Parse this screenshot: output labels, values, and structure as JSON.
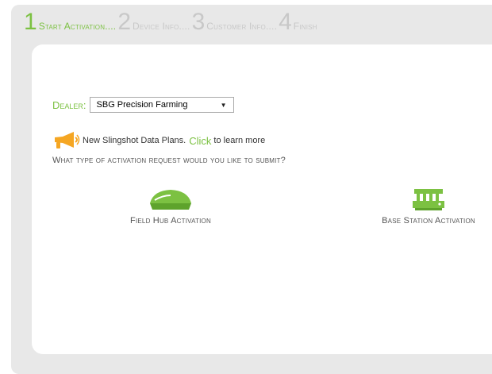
{
  "steps": [
    {
      "number": "1",
      "label": "Start Activation....",
      "active": true
    },
    {
      "number": "2",
      "label": "Device Info....",
      "active": false
    },
    {
      "number": "3",
      "label": "Customer Info....",
      "active": false
    },
    {
      "number": "4",
      "label": "Finish",
      "active": false
    }
  ],
  "dealer": {
    "label": "Dealer:",
    "selected": "SBG Precision Farming"
  },
  "promo": {
    "icon": "megaphone-icon",
    "text_before": "New Slingshot Data Plans.",
    "link": "Click",
    "text_after": "to learn more"
  },
  "question": "What type of activation request would you like to submit?",
  "options": {
    "field_hub": {
      "label": "Field Hub Activation",
      "icon": "field-hub-icon"
    },
    "base_station": {
      "label": "Base Station Activation",
      "icon": "base-station-icon"
    }
  },
  "colors": {
    "accent": "#7cc142",
    "inactive_step": "#c8c8c8",
    "frame": "#e8e8e8",
    "megaphone": "#f5a623"
  }
}
